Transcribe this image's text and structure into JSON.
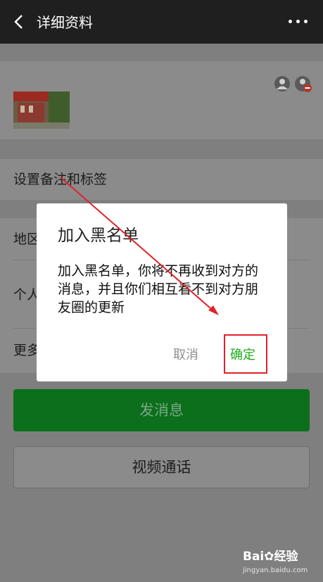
{
  "header": {
    "title": "详细资料",
    "back_icon": "chevron-left-icon",
    "more_icon": "more-dots-icon"
  },
  "rows": {
    "remark_tags": "设置备注和标签",
    "region_partial": "地区",
    "personal_partial": "个人",
    "more_partial": "更多"
  },
  "buttons": {
    "send_message": "发消息",
    "video_call": "视频通话"
  },
  "dialog": {
    "title": "加入黑名单",
    "message": "加入黑名单，你将不再收到对方的消息，并且你们相互看不到对方朋友圈的更新",
    "cancel": "取消",
    "confirm": "确定"
  },
  "colors": {
    "accent_green": "#1aad19",
    "annotation_red": "#e0222a"
  },
  "watermark": {
    "brand": "Bai",
    "brand_cn": "经验",
    "url": "jingyan.baidu.com"
  }
}
